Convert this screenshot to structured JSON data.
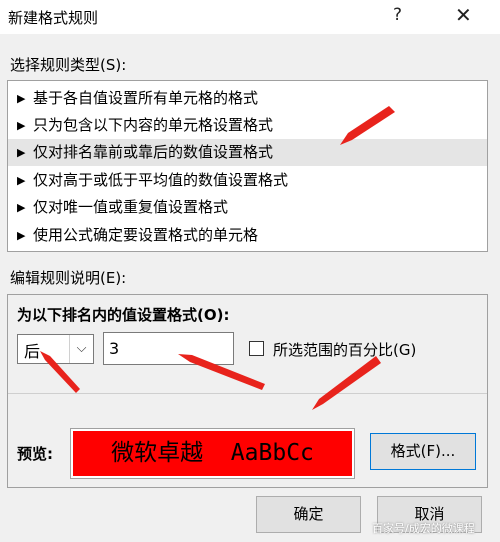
{
  "window": {
    "title": "新建格式规则",
    "help_glyph": "?",
    "close_glyph": "✕"
  },
  "rule_type": {
    "label": "选择规则类型(S):",
    "items": [
      {
        "label": "基于各自值设置所有单元格的格式",
        "selected": false
      },
      {
        "label": "只为包含以下内容的单元格设置格式",
        "selected": false
      },
      {
        "label": "仅对排名靠前或靠后的数值设置格式",
        "selected": true
      },
      {
        "label": "仅对高于或低于平均值的数值设置格式",
        "selected": false
      },
      {
        "label": "仅对唯一值或重复值设置格式",
        "selected": false
      },
      {
        "label": "使用公式确定要设置格式的单元格",
        "selected": false
      }
    ],
    "bullet": "▶"
  },
  "edit_rule": {
    "label": "编辑规则说明(E):",
    "heading": "为以下排名内的值设置格式(O):",
    "rank_direction": "后",
    "rank_value": "3",
    "percent_checkbox_label": "所选范围的百分比(G)",
    "percent_checked": false,
    "preview_label": "预览:",
    "preview_text": "微软卓越  AaBbCc",
    "preview_bg": "#ff0000",
    "format_button": "格式(F)..."
  },
  "buttons": {
    "ok": "确定",
    "cancel": "取消"
  },
  "watermark": "百家号/成宏的微课程",
  "annotation_color": "#e8231c"
}
